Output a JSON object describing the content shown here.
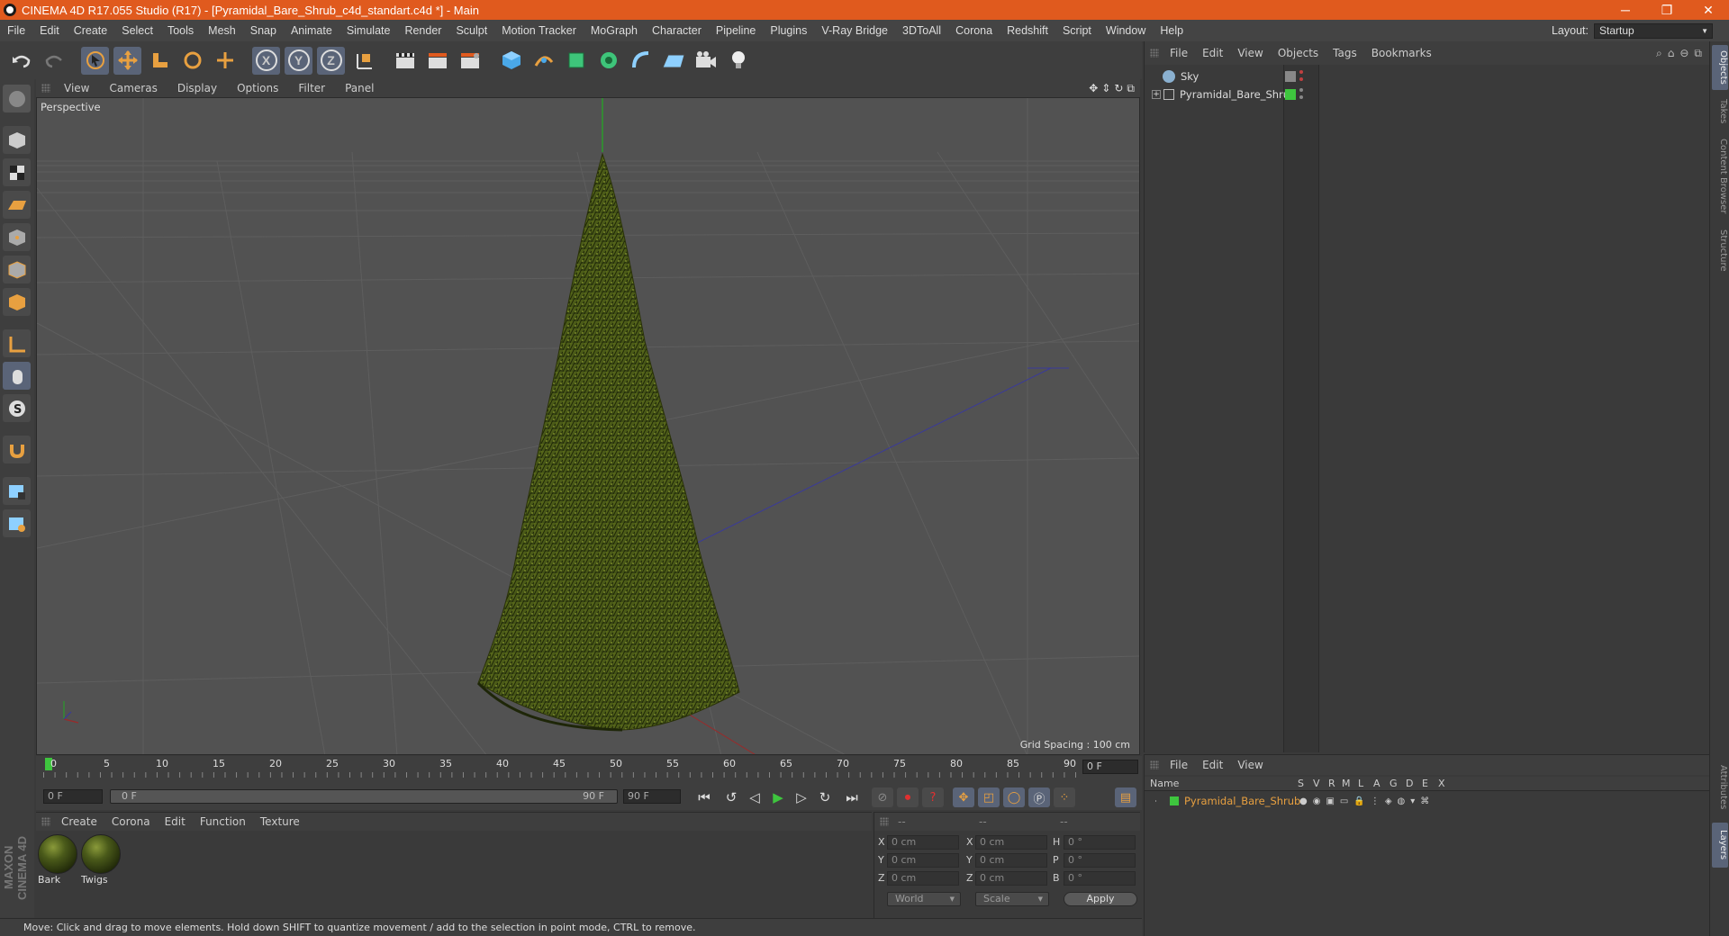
{
  "window": {
    "title": "CINEMA 4D R17.055 Studio (R17) - [Pyramidal_Bare_Shrub_c4d_standart.c4d *] - Main",
    "minimize": "─",
    "maximize": "❐",
    "close": "✕"
  },
  "menu": {
    "items": [
      "File",
      "Edit",
      "Create",
      "Select",
      "Tools",
      "Mesh",
      "Snap",
      "Animate",
      "Simulate",
      "Render",
      "Sculpt",
      "Motion Tracker",
      "MoGraph",
      "Character",
      "Pipeline",
      "Plugins",
      "V-Ray Bridge",
      "3DToAll",
      "Corona",
      "Redshift",
      "Script",
      "Window",
      "Help"
    ],
    "layout_label": "Layout:",
    "layout_value": "Startup"
  },
  "toolbar": {
    "axis_x": "X",
    "axis_y": "Y",
    "axis_z": "Z"
  },
  "viewport": {
    "menu": [
      "View",
      "Cameras",
      "Display",
      "Options",
      "Filter",
      "Panel"
    ],
    "label": "Perspective",
    "grid_spacing": "Grid Spacing : 100 cm"
  },
  "timeline": {
    "ticks": [
      "0",
      "5",
      "10",
      "15",
      "20",
      "25",
      "30",
      "35",
      "40",
      "45",
      "50",
      "55",
      "60",
      "65",
      "70",
      "75",
      "80",
      "85",
      "90"
    ],
    "current_frame": "0 F",
    "start_frame": "0 F",
    "slider_start": "0 F",
    "slider_end": "90 F",
    "end_frame": "90 F"
  },
  "materials": {
    "menu": [
      "Create",
      "Corona",
      "Edit",
      "Function",
      "Texture"
    ],
    "items": [
      {
        "name": "Bark"
      },
      {
        "name": "Twigs"
      }
    ]
  },
  "coords": {
    "header": [
      "--",
      "--",
      "--"
    ],
    "rows": [
      {
        "a": "X",
        "av": "0 cm",
        "b": "X",
        "bv": "0 cm",
        "c": "H",
        "cv": "0 °"
      },
      {
        "a": "Y",
        "av": "0 cm",
        "b": "Y",
        "bv": "0 cm",
        "c": "P",
        "cv": "0 °"
      },
      {
        "a": "Z",
        "av": "0 cm",
        "b": "Z",
        "bv": "0 cm",
        "c": "B",
        "cv": "0 °"
      }
    ],
    "space": "World",
    "mode": "Scale",
    "apply": "Apply"
  },
  "objects": {
    "menu": [
      "File",
      "Edit",
      "View",
      "Objects",
      "Tags",
      "Bookmarks"
    ],
    "items": [
      {
        "name": "Sky"
      },
      {
        "name": "Pyramidal_Bare_Shrub"
      }
    ]
  },
  "layers": {
    "menu": [
      "File",
      "Edit",
      "View"
    ],
    "columns": [
      "Name",
      "S",
      "V",
      "R",
      "M",
      "L",
      "A",
      "G",
      "D",
      "E",
      "X"
    ],
    "items": [
      {
        "name": "Pyramidal_Bare_Shrub",
        "color": "#3ec53e"
      }
    ]
  },
  "sidetabs": [
    "Objects",
    "Takes",
    "Content Browser",
    "Structure",
    "Attributes",
    "Layers"
  ],
  "status": "Move: Click and drag to move elements. Hold down SHIFT to quantize movement / add to the selection in point mode, CTRL to remove.",
  "brand": "MAXON CINEMA 4D",
  "colors": {
    "title_bar": "#e05a1e",
    "accent_blue": "#5a6478",
    "layer_green": "#3ec53e",
    "object_orange": "#e8a040"
  }
}
